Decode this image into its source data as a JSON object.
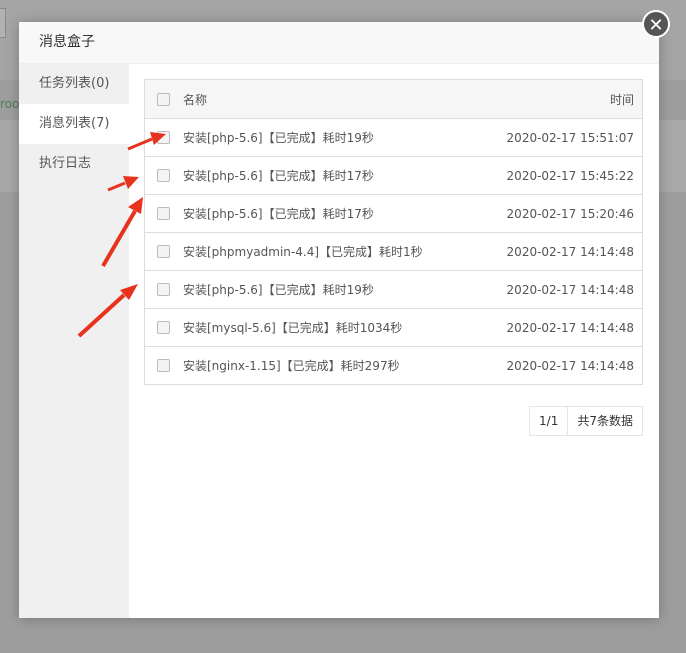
{
  "background": {
    "partial_text": "roo"
  },
  "modal": {
    "title": "消息盒子",
    "close_glyph": "✕"
  },
  "sidebar": {
    "items": [
      {
        "label": "任务列表(0)",
        "active": false
      },
      {
        "label": "消息列表(7)",
        "active": true
      },
      {
        "label": "执行日志",
        "active": false
      }
    ]
  },
  "table": {
    "headers": {
      "name": "名称",
      "time": "时间"
    },
    "rows": [
      {
        "name": "安装[php-5.6]【已完成】耗时19秒",
        "time": "2020-02-17 15:51:07"
      },
      {
        "name": "安装[php-5.6]【已完成】耗时17秒",
        "time": "2020-02-17 15:45:22"
      },
      {
        "name": "安装[php-5.6]【已完成】耗时17秒",
        "time": "2020-02-17 15:20:46"
      },
      {
        "name": "安装[phpmyadmin-4.4]【已完成】耗时1秒",
        "time": "2020-02-17 14:14:48"
      },
      {
        "name": "安装[php-5.6]【已完成】耗时19秒",
        "time": "2020-02-17 14:14:48"
      },
      {
        "name": "安装[mysql-5.6]【已完成】耗时1034秒",
        "time": "2020-02-17 14:14:48"
      },
      {
        "name": "安装[nginx-1.15]【已完成】耗时297秒",
        "time": "2020-02-17 14:14:48"
      }
    ]
  },
  "pager": {
    "page": "1/1",
    "total": "共7条数据"
  },
  "colors": {
    "annotation_arrow": "#e8321e",
    "close_button": "#555555"
  }
}
